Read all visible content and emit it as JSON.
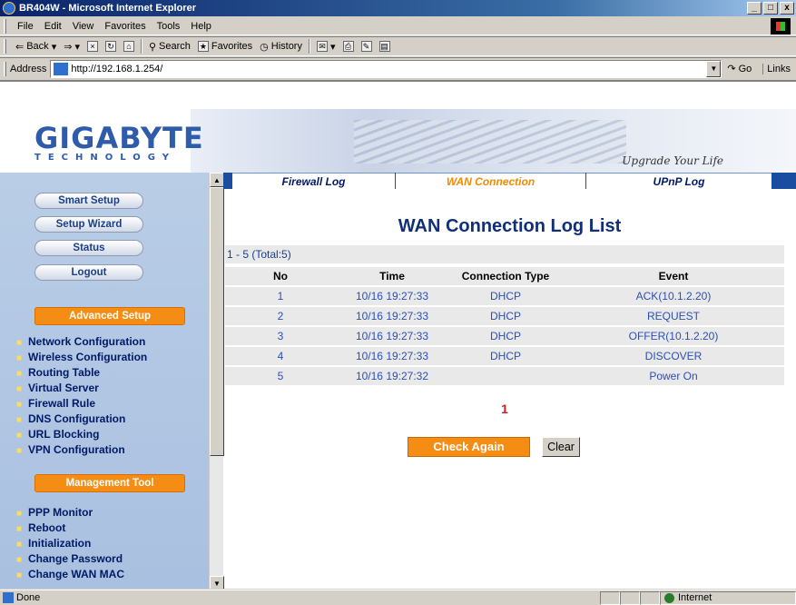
{
  "window": {
    "title": "BR404W - Microsoft Internet Explorer",
    "min": "_",
    "max": "0",
    "close": "x"
  },
  "menu": [
    "File",
    "Edit",
    "View",
    "Favorites",
    "Tools",
    "Help"
  ],
  "toolbar": {
    "back": "Back",
    "forward": "",
    "stop": "",
    "refresh": "",
    "home": "",
    "search": "Search",
    "favorites": "Favorites",
    "history": "History"
  },
  "address": {
    "label": "Address",
    "url": "http://192.168.1.254/",
    "go": "Go",
    "links": "Links"
  },
  "banner": {
    "brand": "GIGABYTE",
    "sub": "TECHNOLOGY",
    "slogan": "Upgrade Your Life"
  },
  "sidebar": {
    "buttons": [
      "Smart Setup",
      "Setup Wizard",
      "Status",
      "Logout"
    ],
    "advanced_header": "Advanced Setup",
    "advanced_links": [
      "Network Configuration",
      "Wireless Configuration",
      "Routing Table",
      "Virtual Server",
      "Firewall Rule",
      "DNS Configuration",
      "URL Blocking",
      "VPN Configuration"
    ],
    "mgmt_header": "Management Tool",
    "mgmt_links": [
      "PPP Monitor",
      "Reboot",
      "Initialization",
      "Change Password",
      "Change WAN MAC"
    ]
  },
  "tabs": [
    {
      "label": "Firewall Log",
      "active": false
    },
    {
      "label": "WAN Connection",
      "active": true
    },
    {
      "label": "UPnP Log",
      "active": false
    }
  ],
  "main": {
    "title": "WAN Connection Log List",
    "range": "1 - 5 (Total:5)",
    "columns": [
      "No",
      "Time",
      "Connection Type",
      "Event"
    ],
    "rows": [
      [
        "1",
        "10/16 19:27:33",
        "DHCP",
        "ACK(10.1.2.20)"
      ],
      [
        "2",
        "10/16 19:27:33",
        "DHCP",
        "REQUEST"
      ],
      [
        "3",
        "10/16 19:27:33",
        "DHCP",
        "OFFER(10.1.2.20)"
      ],
      [
        "4",
        "10/16 19:27:33",
        "DHCP",
        "DISCOVER"
      ],
      [
        "5",
        "10/16 19:27:32",
        "",
        "Power On"
      ]
    ],
    "page": "1",
    "check_again": "Check Again",
    "clear": "Clear"
  },
  "status": {
    "text": "Done",
    "zone": "Internet"
  },
  "colors": {
    "accent": "#f58d14",
    "brand": "#2f5caa",
    "link": "#2a4fb8"
  }
}
